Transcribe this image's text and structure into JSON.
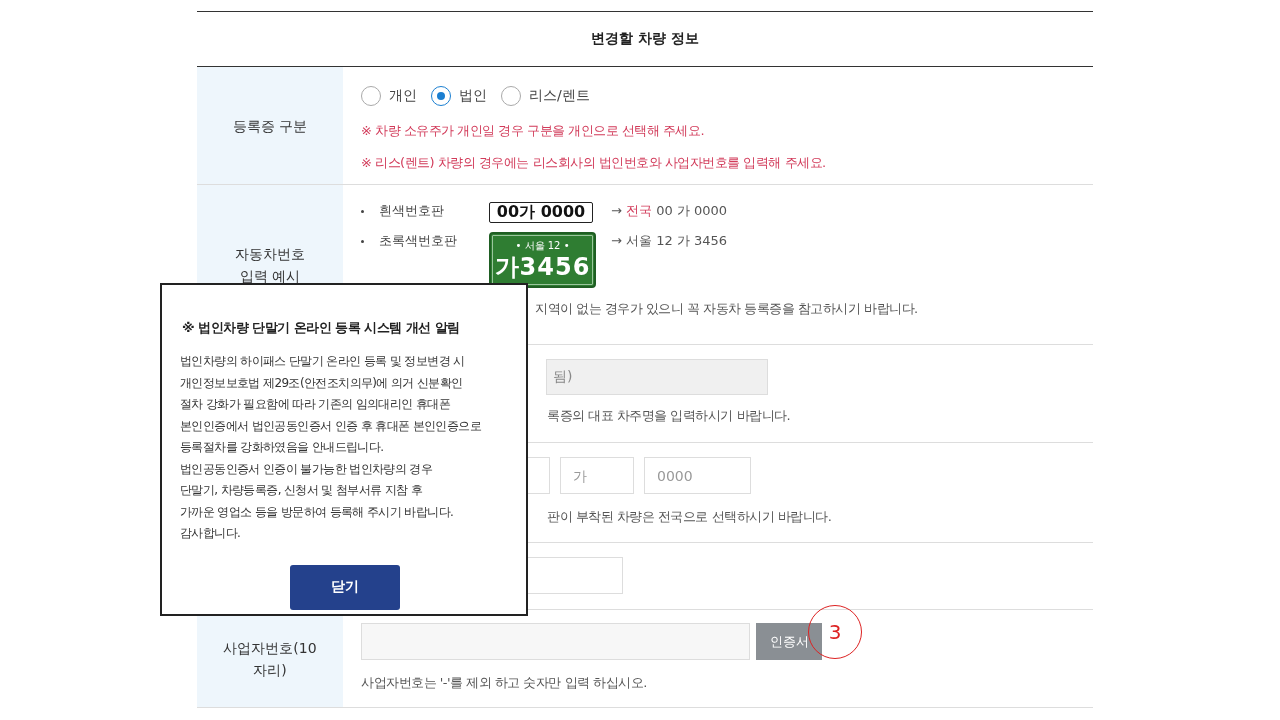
{
  "header": {
    "title": "변경할 차량 정보"
  },
  "rows": [
    {
      "kind": "radio",
      "label": "등록증 구분",
      "options": [
        {
          "label": "개인",
          "selected": false
        },
        {
          "label": "법인",
          "selected": true
        },
        {
          "label": "리스/렌트",
          "selected": false
        }
      ],
      "notes": [
        "※ 차량 소유주가 개인일 경우 구분을 개인으로 선택해 주세요.",
        "※ 리스(렌트) 차량의 경우에는 리스회사의 법인번호와 사업자번호를 입력해 주세요."
      ]
    },
    {
      "kind": "plates",
      "label_lines": [
        "자동차번호",
        "입력 예시"
      ],
      "examples": [
        {
          "kind": "white",
          "name": "흰색번호판",
          "plate_lines": [
            "00가 0000"
          ],
          "result_prefix": "→ ",
          "result_highlight": "전국",
          "result_rest": " 00 가 0000"
        },
        {
          "kind": "green",
          "name": "초록색번호판",
          "plate_lines": [
            "• 서울 12 •",
            "가3456"
          ],
          "result_prefix": "→ 서울 12 가 3456"
        }
      ],
      "note": "지역이 없는 경우가 있으니 꼭 자동차 등록증을 참고하시기 바랍니다."
    },
    {
      "kind": "owner",
      "value": "됨)",
      "hint": "록증의 대표 차주명을 입력하시기 바랍니다."
    },
    {
      "kind": "number",
      "placeholders": [
        "가",
        "0000"
      ],
      "hint": "판이 부착된 차량은 전국으로 선택하시기 바랍니다."
    },
    {
      "kind": "field"
    },
    {
      "kind": "business",
      "label": "사업자번호(10자리)",
      "button": "인증서",
      "hint": "사업자번호는 '-'를 제외 하고 숫자만 입력 하십시오."
    }
  ],
  "annotation": {
    "label": "3"
  },
  "dialog": {
    "title": "※ 법인차량 단말기 온라인 등록 시스템 개선 알림",
    "body_lines": [
      "법인차량의 하이패스 단말기 온라인 등록 및 정보변경 시",
      "개인정보보호법 제29조(안전조치의무)에 의거 신분확인",
      "절차 강화가 필요함에 따라 기존의 임의대리인 휴대폰",
      "본인인증에서 법인공동인증서 인증 후 휴대폰 본인인증으로",
      "등록절차를 강화하였음을 안내드립니다.",
      "법인공동인증서 인증이 불가능한 법인차량의 경우",
      "단말기, 차량등록증, 신청서 및 첨부서류 지참 후",
      "가까운 영업소 등을 방문하여 등록해 주시기 바랍니다.",
      "감사합니다."
    ],
    "close": "닫기"
  }
}
